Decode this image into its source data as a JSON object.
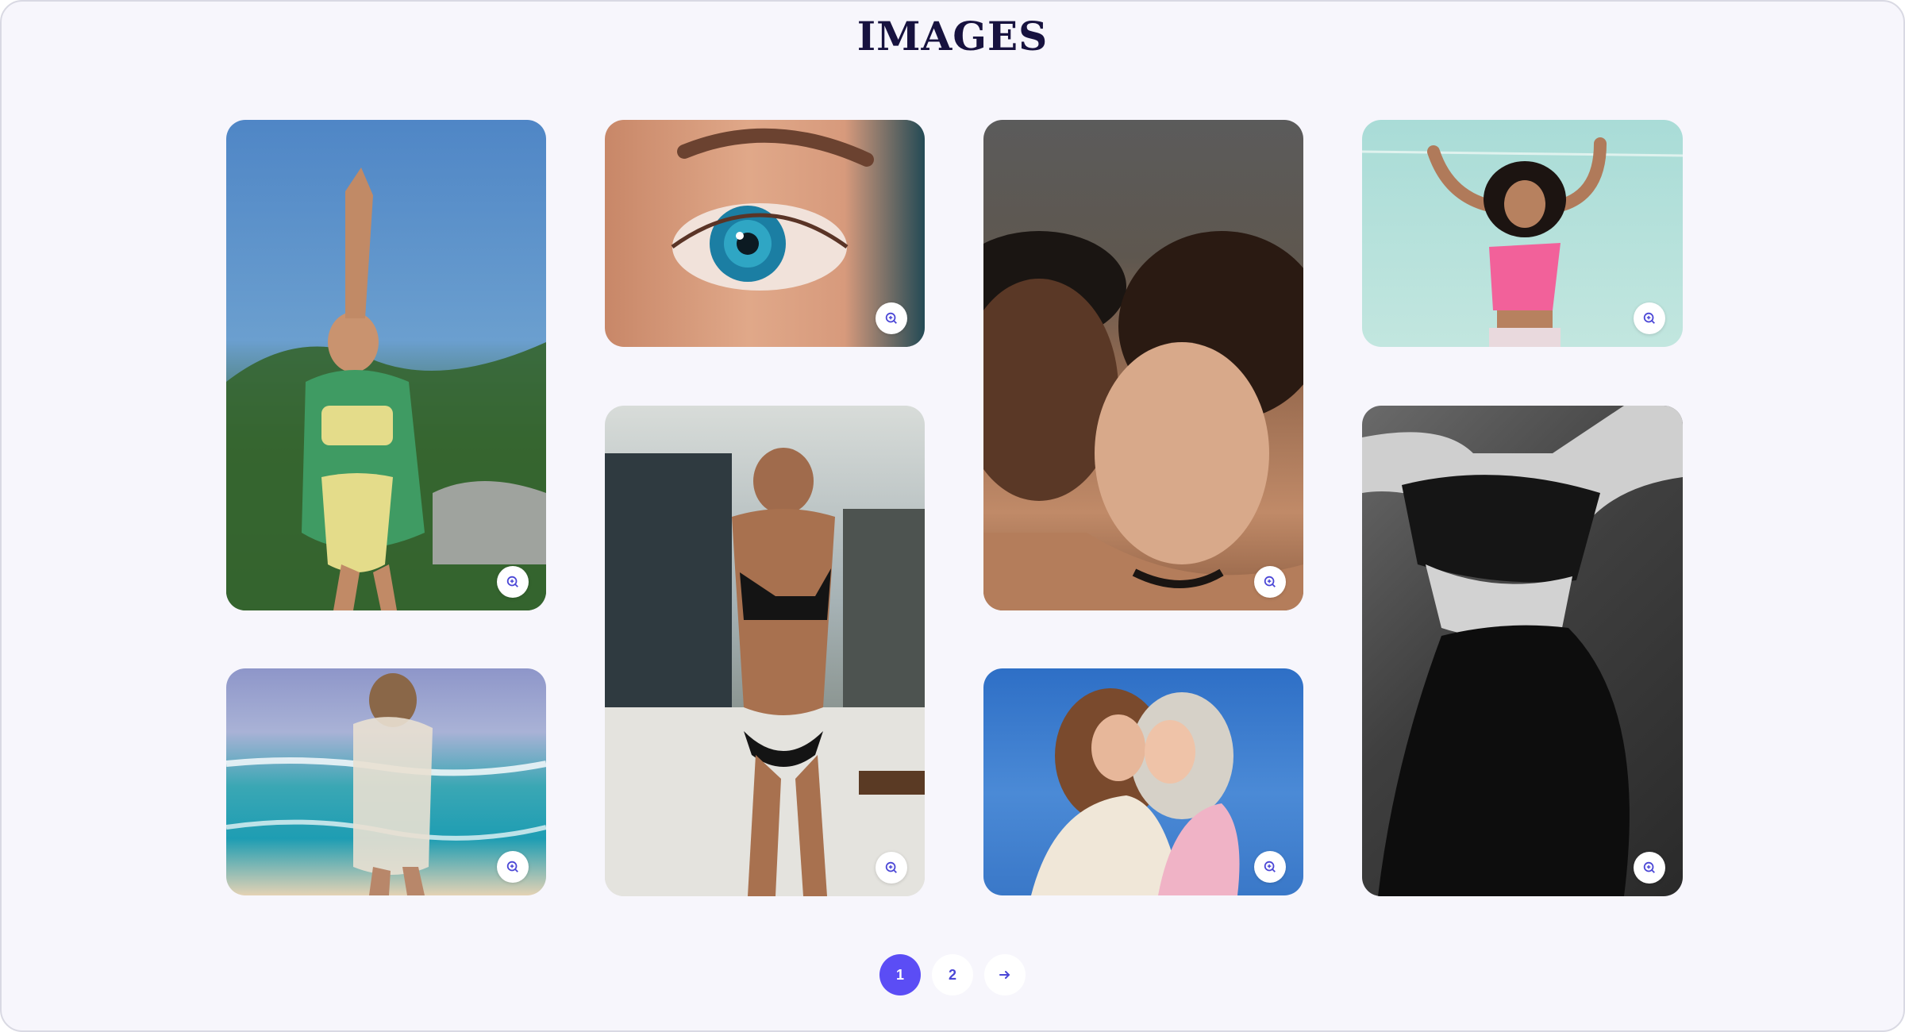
{
  "page": {
    "title": "IMAGES",
    "accent_color": "#5b4df5",
    "background_color": "#f7f6fc"
  },
  "gallery": {
    "cards": [
      {
        "id": "woman-bikini-tropical",
        "zoom_icon": "zoom-in-icon"
      },
      {
        "id": "blue-eye-closeup",
        "zoom_icon": "zoom-in-icon"
      },
      {
        "id": "two-women-embrace",
        "zoom_icon": "zoom-in-icon"
      },
      {
        "id": "woman-pink-top",
        "zoom_icon": "zoom-in-icon"
      },
      {
        "id": "woman-black-bikini",
        "zoom_icon": "zoom-in-icon"
      },
      {
        "id": "woman-bw-activewear",
        "zoom_icon": "zoom-in-icon"
      },
      {
        "id": "woman-beach-coverup",
        "zoom_icon": "zoom-in-icon"
      },
      {
        "id": "two-women-hug-sky",
        "zoom_icon": "zoom-in-icon"
      }
    ]
  },
  "pagination": {
    "pages": [
      "1",
      "2"
    ],
    "current": "1",
    "next_icon": "arrow-right-icon"
  }
}
